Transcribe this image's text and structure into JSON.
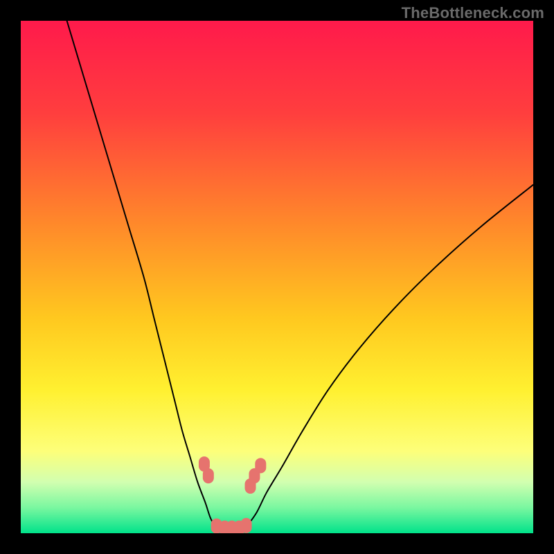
{
  "watermark": "TheBottleneck.com",
  "chart_data": {
    "type": "line",
    "title": "",
    "xlabel": "",
    "ylabel": "",
    "xlim": [
      0,
      100
    ],
    "ylim": [
      0,
      100
    ],
    "background_gradient": {
      "stops": [
        {
          "offset": 0.0,
          "color": "#ff1a4b"
        },
        {
          "offset": 0.18,
          "color": "#ff3e3e"
        },
        {
          "offset": 0.4,
          "color": "#ff8a2a"
        },
        {
          "offset": 0.58,
          "color": "#ffc81f"
        },
        {
          "offset": 0.72,
          "color": "#fff030"
        },
        {
          "offset": 0.84,
          "color": "#fdff7a"
        },
        {
          "offset": 0.9,
          "color": "#d2ffb0"
        },
        {
          "offset": 0.95,
          "color": "#7af7a0"
        },
        {
          "offset": 1.0,
          "color": "#00e28a"
        }
      ]
    },
    "series": [
      {
        "name": "left-branch",
        "type": "line",
        "color": "#000000",
        "width": 2.0,
        "x": [
          9,
          12,
          15,
          18,
          21,
          24,
          26,
          28,
          30,
          31.5,
          33,
          34.5,
          36,
          37,
          38
        ],
        "y": [
          100,
          90,
          80,
          70,
          60,
          50,
          42,
          34,
          26,
          20,
          15,
          10,
          6,
          3,
          1.2
        ]
      },
      {
        "name": "right-branch",
        "type": "line",
        "color": "#000000",
        "width": 2.0,
        "x": [
          44,
          46,
          48,
          51,
          55,
          60,
          66,
          73,
          81,
          90,
          100
        ],
        "y": [
          1.2,
          4,
          8,
          13,
          20,
          28,
          36,
          44,
          52,
          60,
          68
        ]
      },
      {
        "name": "optimal-zone-markers",
        "type": "scatter",
        "color": "#e6736e",
        "marker_kind": "pill",
        "x": [
          35.8,
          36.6,
          38.2,
          39.8,
          41.2,
          42.6,
          44.0,
          44.8,
          45.6,
          46.8
        ],
        "y": [
          13.5,
          11.2,
          1.4,
          1.0,
          1.0,
          1.0,
          1.5,
          9.2,
          11.2,
          13.2
        ]
      }
    ]
  }
}
